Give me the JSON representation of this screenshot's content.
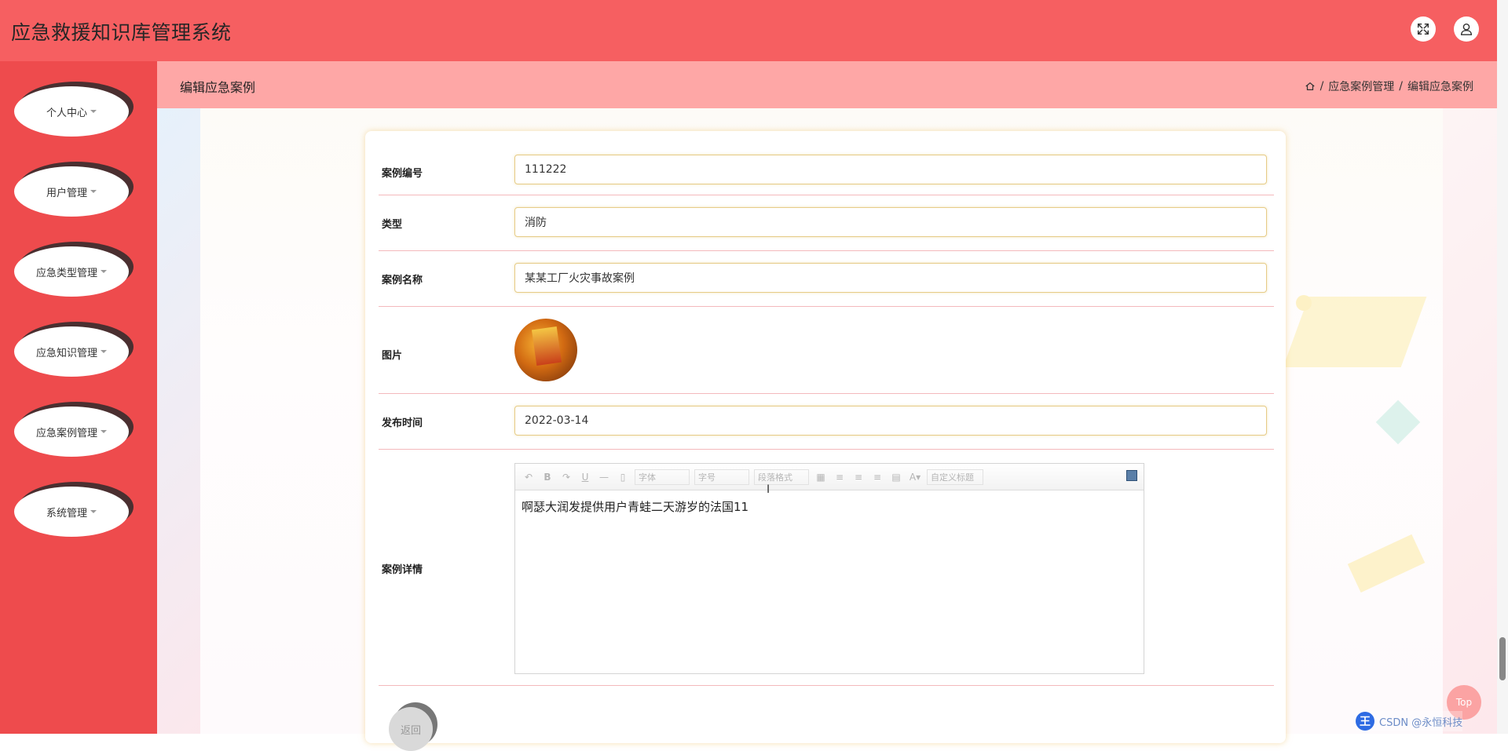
{
  "header": {
    "title": "应急救援知识库管理系统",
    "fullscreen_icon": "expand-icon",
    "user_icon": "user-icon"
  },
  "sidebar": {
    "items": [
      {
        "label": "个人中心"
      },
      {
        "label": "用户管理"
      },
      {
        "label": "应急类型管理"
      },
      {
        "label": "应急知识管理"
      },
      {
        "label": "应急案例管理"
      },
      {
        "label": "系统管理"
      }
    ]
  },
  "page": {
    "title": "编辑应急案例",
    "breadcrumb": [
      "应急案例管理",
      "编辑应急案例"
    ],
    "breadcrumb_sep": "/"
  },
  "form": {
    "case_no_label": "案例编号",
    "case_no_value": "111222",
    "type_label": "类型",
    "type_value": "消防",
    "name_label": "案例名称",
    "name_value": "某某工厂火灾事故案例",
    "image_label": "图片",
    "date_label": "发布时间",
    "date_value": "2022-03-14",
    "detail_label": "案例详情",
    "editor": {
      "font_select": "字体",
      "size_select": "字号",
      "paragraph_select": "段落格式",
      "custom_title_select": "自定义标题",
      "content": "啊瑟大润发提供用户青蛙二天游岁的法国11"
    },
    "back_label": "返回"
  },
  "float": {
    "top_label": "Top",
    "watermark_logo": "王",
    "watermark_text": "CSDN @永恒科技"
  },
  "colors": {
    "topbar": "#f65f61",
    "sidebar": "#ee4b4d",
    "breadcrumb_bar": "#fea7a6",
    "input_border": "#e6cc88"
  }
}
